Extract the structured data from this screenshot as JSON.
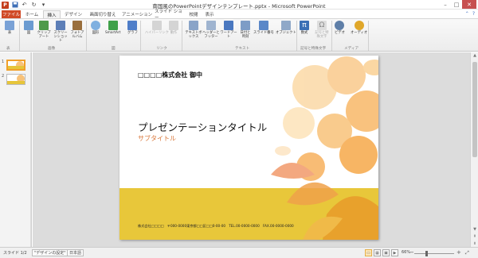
{
  "app": {
    "window_title": "南国風のPowerPointデザインテンプレート.pptx - Microsoft PowerPoint",
    "accent": "#d04a26"
  },
  "qat": [
    "save-icon",
    "undo-icon",
    "redo-icon",
    "customize-icon"
  ],
  "tabs": [
    {
      "label": "ファイル",
      "name": "tab-file"
    },
    {
      "label": "ホーム",
      "name": "tab-home"
    },
    {
      "label": "挿入",
      "name": "tab-insert"
    },
    {
      "label": "デザイン",
      "name": "tab-design"
    },
    {
      "label": "画面切り替え",
      "name": "tab-transitions"
    },
    {
      "label": "アニメーション",
      "name": "tab-animations"
    },
    {
      "label": "スライド ショー",
      "name": "tab-slideshow"
    },
    {
      "label": "校閲",
      "name": "tab-review"
    },
    {
      "label": "表示",
      "name": "tab-view"
    }
  ],
  "ribbon": {
    "buttons": [
      {
        "label": "表",
        "color": "#7aa2d6",
        "name": "table-button"
      },
      {
        "label": "図",
        "color": "#6b9bd1",
        "name": "picture-button"
      },
      {
        "label": "クリップアート",
        "color": "#4e9a4a",
        "name": "clipart-button"
      },
      {
        "label": "スクリーンショット",
        "color": "#5d7fb8",
        "name": "screenshot-button"
      },
      {
        "label": "フォトアルバム",
        "color": "#9a6f3c",
        "name": "photo-album-button"
      },
      {
        "label": "図形",
        "color": "#7fb0e0",
        "name": "shapes-button"
      },
      {
        "label": "SmartArt",
        "color": "#3fa14a",
        "name": "smartart-button"
      },
      {
        "label": "グラフ",
        "color": "#4f7ec9",
        "name": "chart-button"
      },
      {
        "label": "ハイパーリンク",
        "color": "#c9c9c9",
        "name": "hyperlink-button"
      },
      {
        "label": "動作",
        "color": "#c9c9c9",
        "name": "action-button"
      },
      {
        "label": "テキストボックス",
        "color": "#8aa4c8",
        "name": "textbox-button"
      },
      {
        "label": "ヘッダーとフッター",
        "color": "#9fb4d0",
        "name": "header-footer-button"
      },
      {
        "label": "ワードアート",
        "color": "#4a78c0",
        "name": "wordart-button"
      },
      {
        "label": "日付と時刻",
        "color": "#7d9cc6",
        "name": "date-time-button"
      },
      {
        "label": "スライド番号",
        "color": "#5b88c8",
        "name": "slide-number-button"
      },
      {
        "label": "オブジェクト",
        "color": "#8fa8c8",
        "name": "object-button"
      },
      {
        "label": "数式",
        "color": "#3a6fb5",
        "name": "equation-button"
      },
      {
        "label": "記号と特殊文字",
        "color": "#c9c9c9",
        "name": "symbol-button"
      },
      {
        "label": "ビデオ",
        "color": "#5f7fa8",
        "name": "video-button"
      },
      {
        "label": "オーディオ",
        "color": "#e0a72a",
        "name": "audio-button"
      }
    ],
    "groups": [
      "表",
      "画像",
      "図",
      "リンク",
      "テキスト",
      "記号と特殊文字",
      "メディア"
    ]
  },
  "thumbnails": [
    {
      "number": "1"
    },
    {
      "number": "2"
    }
  ],
  "slide": {
    "company": "□□□□株式会社 御中",
    "title": "プレゼンテーションタイトル",
    "subtitle": "サブタイトル",
    "footer": "株式会社□□□□　〒000-0000東京都□□区□□0-00-00　TEL.00-0000-0000　FAX.00-0000-0000",
    "colors": {
      "band": "#e8c73a",
      "subtitle": "#d9783c",
      "flower": "#f6b86a"
    }
  },
  "status": {
    "slide": "スライド 1/2",
    "theme": "\"デザインの設定\"",
    "language": "日本語",
    "zoom": "66%",
    "zoom_percent": 66
  }
}
